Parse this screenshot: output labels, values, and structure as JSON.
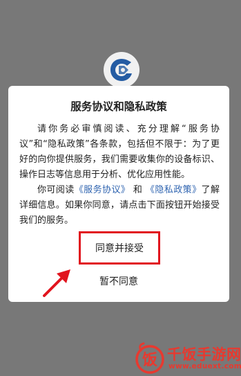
{
  "dialog": {
    "title": "服务协议和隐私政策",
    "para1": "请你务必审慎阅读、充分理解“服务协议”和“隐私政策”各条款，包括但不限于：为了更好的向你提供服务，我们需要收集你的设备标识、操作日志等信息用于分析、优化应用性能。",
    "para2_before": "你可阅读",
    "service_link": "《服务协议》",
    "para2_and": "和",
    "privacy_link": "《隐私政策》",
    "para2_after": "了解详细信息。如果你同意，请点击下面按钮开始接受我们的服务。",
    "agree_label": "同意并接受",
    "disagree_label": "暂不同意"
  },
  "watermark": {
    "logo_char": "饭",
    "name": "千饭手游网",
    "url": "www.eduext.com"
  },
  "colors": {
    "overlay": "#787878",
    "link": "#2f64b0",
    "highlight": "#e1141e",
    "watermark": "#e8392f"
  },
  "icons": {
    "app_logo": "shield-swirl-logo-icon",
    "annotation": "red-arrow-icon"
  }
}
